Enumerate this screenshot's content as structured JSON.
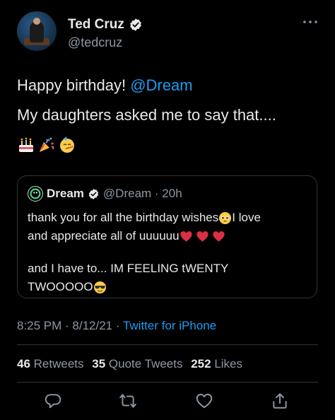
{
  "author": {
    "display_name": "Ted Cruz",
    "handle": "@tedcruz"
  },
  "tweet": {
    "text_part1": "Happy birthday! ",
    "mention": "@Dream",
    "text_line2": "My daughters asked me to say that....",
    "emojis": [
      "birthday-cake",
      "party-popper",
      "partying-face"
    ]
  },
  "quoted": {
    "name": "Dream",
    "handle_time": "@Dream · 20h",
    "line1_a": "thank you for all the birthday wishes ",
    "line1_b": " I love",
    "line2": "and appreciate all of uuuuuu",
    "line3": "and I have to... IM FEELING tWENTY",
    "line4": "TWOOOOO "
  },
  "meta": {
    "timestamp": "8:25 PM · 8/12/21 · ",
    "source": "Twitter for iPhone"
  },
  "stats": {
    "retweets_count": "46",
    "retweets_label": " Retweets",
    "quotes_count": "35",
    "quotes_label": " Quote Tweets",
    "likes_count": "252",
    "likes_label": " Likes"
  },
  "colors": {
    "background": "#000000",
    "text": "#e7e9ea",
    "secondary": "#8b98a5",
    "accent": "#1d9bf0",
    "border": "#2f3336"
  }
}
